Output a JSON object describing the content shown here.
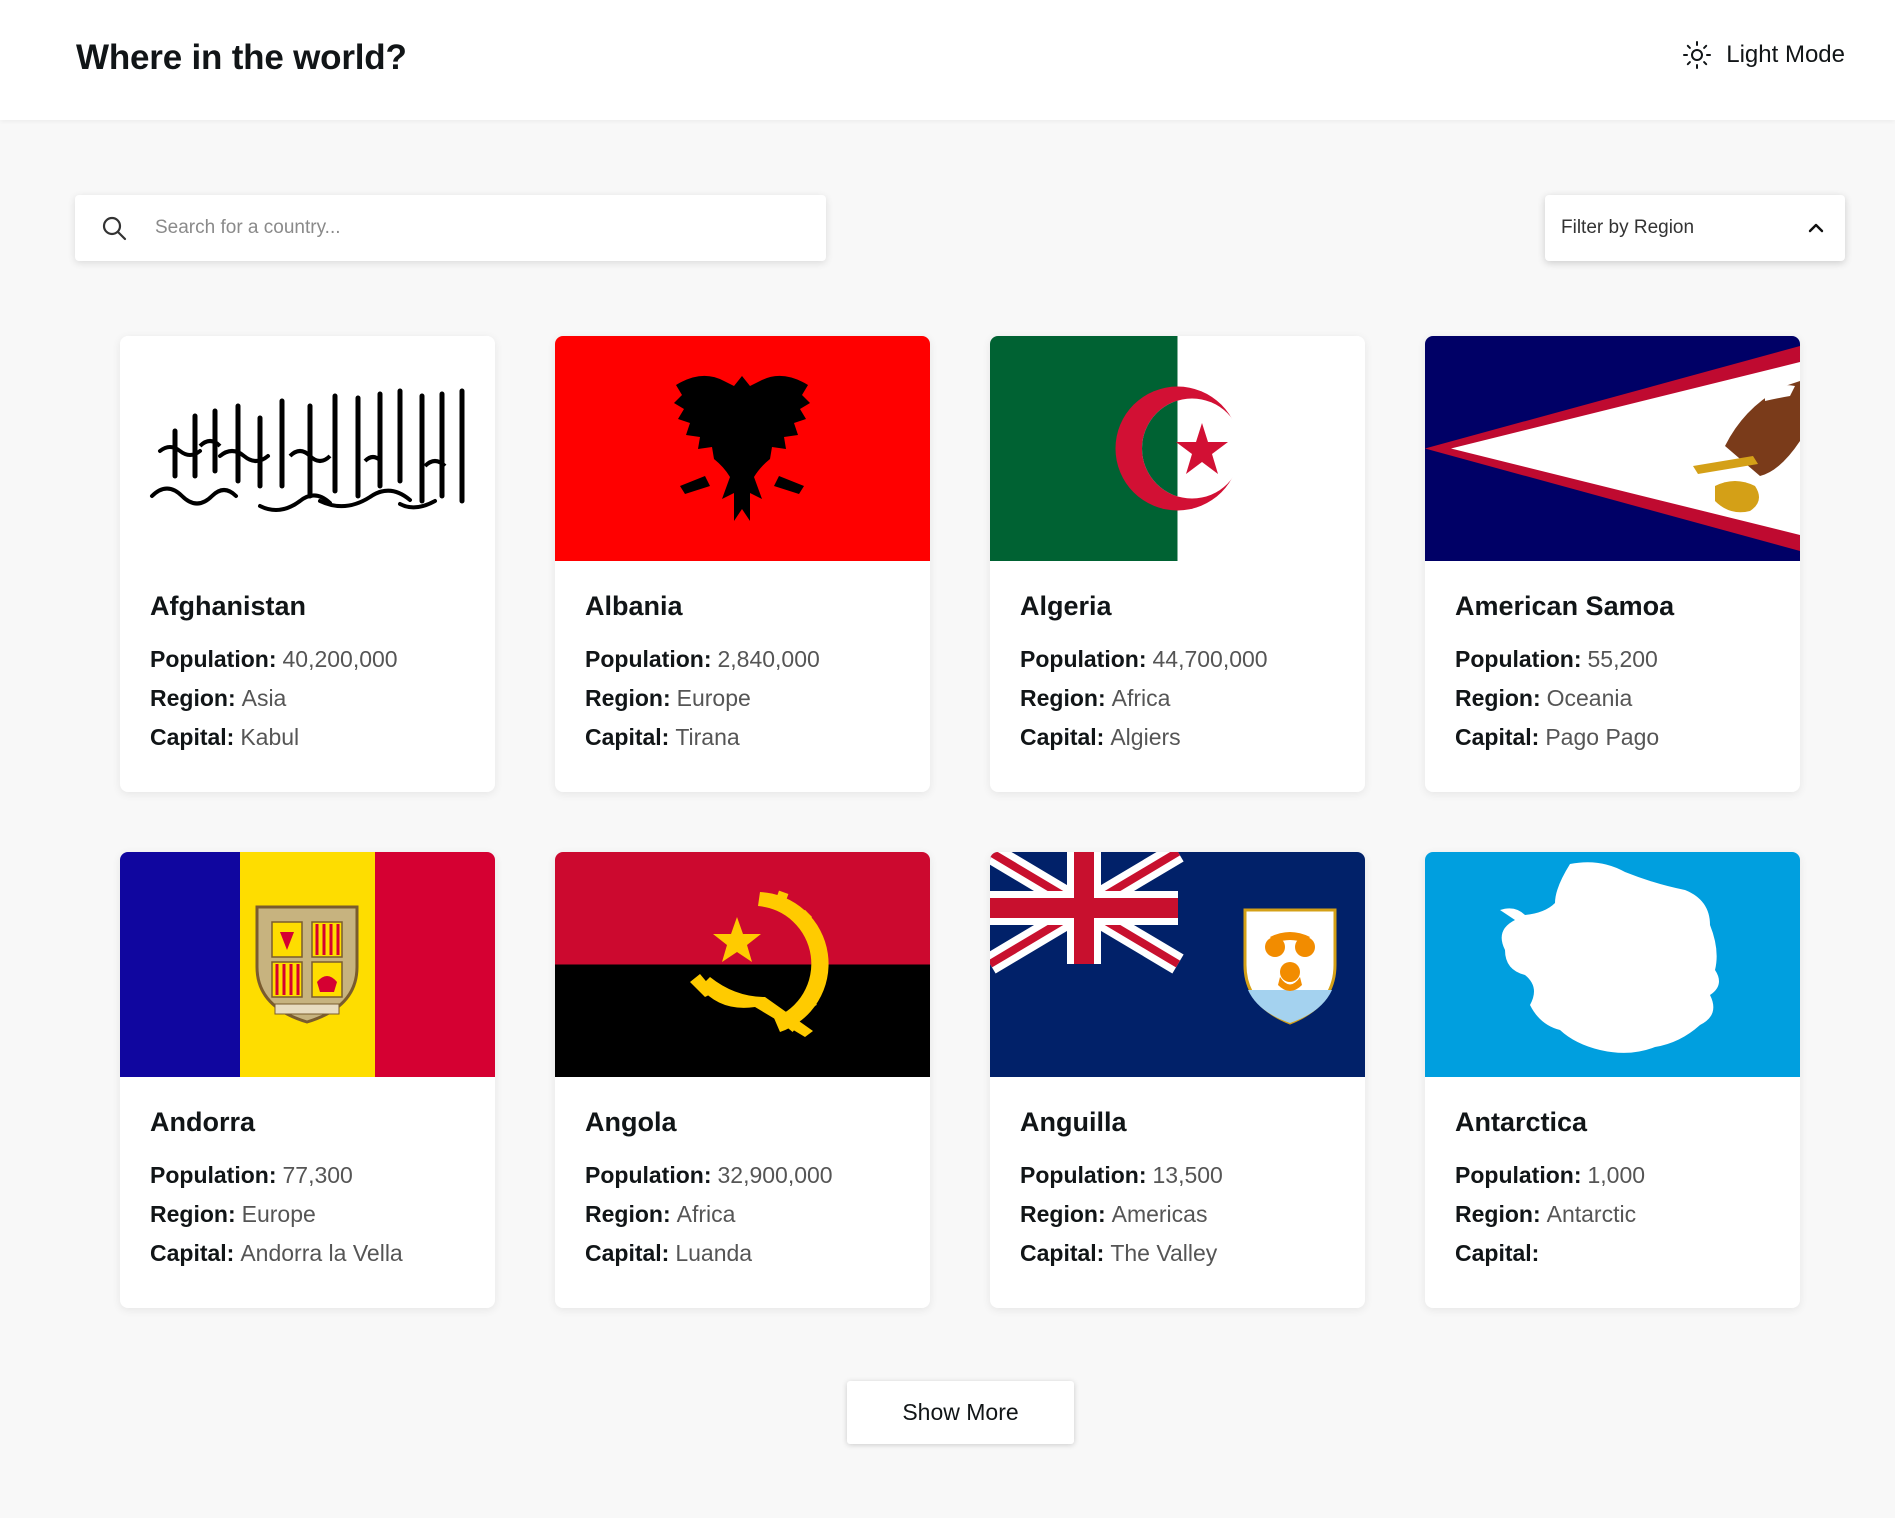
{
  "header": {
    "title": "Where in the world?",
    "theme_toggle_label": "Light Mode",
    "theme_icon": "sun-icon"
  },
  "search": {
    "placeholder": "Search for a country...",
    "value": "",
    "icon": "search-icon"
  },
  "filter": {
    "label": "Filter by Region",
    "icon": "chevron-up-icon"
  },
  "labels": {
    "population": "Population:",
    "region": "Region:",
    "capital": "Capital:"
  },
  "countries": [
    {
      "name": "Afghanistan",
      "population": "40,200,000",
      "region": "Asia",
      "capital": "Kabul",
      "flag": "afghanistan-flag"
    },
    {
      "name": "Albania",
      "population": "2,840,000",
      "region": "Europe",
      "capital": "Tirana",
      "flag": "albania-flag"
    },
    {
      "name": "Algeria",
      "population": "44,700,000",
      "region": "Africa",
      "capital": "Algiers",
      "flag": "algeria-flag"
    },
    {
      "name": "American Samoa",
      "population": "55,200",
      "region": "Oceania",
      "capital": "Pago Pago",
      "flag": "american-samoa-flag"
    },
    {
      "name": "Andorra",
      "population": "77,300",
      "region": "Europe",
      "capital": "Andorra la Vella",
      "flag": "andorra-flag"
    },
    {
      "name": "Angola",
      "population": "32,900,000",
      "region": "Africa",
      "capital": "Luanda",
      "flag": "angola-flag"
    },
    {
      "name": "Anguilla",
      "population": "13,500",
      "region": "Americas",
      "capital": "The Valley",
      "flag": "anguilla-flag"
    },
    {
      "name": "Antarctica",
      "population": "1,000",
      "region": "Antarctic",
      "capital": "",
      "flag": "antarctica-flag"
    }
  ],
  "show_more_label": "Show More",
  "colors": {
    "background": "#f8f8f8",
    "card": "#ffffff",
    "text": "#111517"
  }
}
